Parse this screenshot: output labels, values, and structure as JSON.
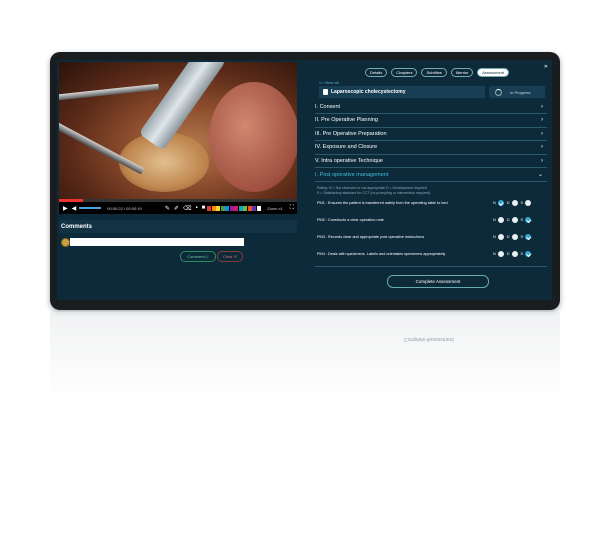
{
  "video": {
    "time": "00:00:22 / 00:00:19",
    "zoom_label": "Zoom",
    "zoom_value": "x1",
    "palette": [
      "#e53935",
      "#fb8c00",
      "#fdd835",
      "#43a047",
      "#1e88e5",
      "#8e24aa",
      "#d81b60",
      "#00acc1",
      "#7cb342",
      "#f4511e",
      "#5e35b1",
      "#ffffff"
    ],
    "progress_fraction": 0.1
  },
  "comments": {
    "title": "Comments",
    "comment_button": "Comment ▷",
    "clear_button": "Clear ✕"
  },
  "tabs": [
    "Details",
    "Chapters",
    "Subtitles",
    "Mentor",
    "Assessment"
  ],
  "active_tab": "Assessment",
  "view_all": "<< View all",
  "procedure": {
    "title": "Laparoscopic cholecystectomy",
    "status": "In Progress"
  },
  "sections": [
    "I. Consent",
    "II. Pre Operative Planning",
    "III. Pre Operative Preparation",
    "IV. Exposure and Closure",
    "V. Intra operative Technique"
  ],
  "open_section": "I. Post operative management",
  "rating_note_1": "Rating: N = Not observed or not appropriate  D = Development required",
  "rating_note_2": "S = Satisfactory standard for CCT (no prompting or intervention required)",
  "pm_items": [
    {
      "label": "PM1 : Ensures the patient is transferred safely from the operating table to bed",
      "selected": "N"
    },
    {
      "label": "PM2 : Constructs a clear operation note",
      "selected": "S"
    },
    {
      "label": "PM3 : Records clear and appropriate post operative instructions",
      "selected": "S"
    },
    {
      "label": "PM4 : Deals with specimens. Labels and orientates specimens appropriately",
      "selected": "S"
    }
  ],
  "options": [
    "N",
    "D",
    "S"
  ],
  "complete_button": "Complete Assessment"
}
